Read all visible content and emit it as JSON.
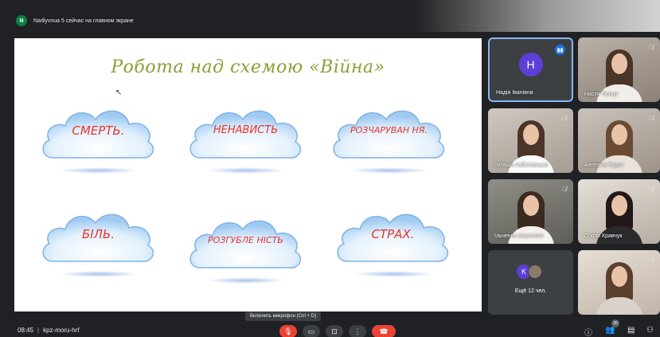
{
  "notification": {
    "avatar_letter": "N",
    "text": "Nadiyvnua 5 сейчас на главном экране"
  },
  "slide": {
    "title": "Робота над схемою «Війна»",
    "clouds": [
      "СМЕРТЬ.",
      "НЕНАВИСТЬ",
      "РОЗЧАРУВАН НЯ.",
      "БІЛЬ.",
      "РОЗГУБЛЕ НІСТЬ",
      "СТРАХ."
    ]
  },
  "participants": [
    {
      "name": "Надія Іванівна",
      "avatar_letter": "H",
      "speaking": true
    },
    {
      "name": "Настя Ткачук",
      "muted": true
    },
    {
      "name": "наташа лабачевська",
      "muted": true
    },
    {
      "name": "Ангеліна Рудич",
      "muted": true
    },
    {
      "name": "Ільченко Анастасія",
      "muted": true
    },
    {
      "name": "Софія Кравчук",
      "muted": true
    },
    {
      "name": "",
      "muted": true
    }
  ],
  "more_tile": {
    "avatar_letter": "K",
    "label": "Ещё 12 чел."
  },
  "tooltip": "Включить микрофон (Ctrl + D)",
  "meeting": {
    "time": "08:45",
    "code": "kpz-moru-hrf",
    "participants_count": "20"
  },
  "colors": {
    "accent": "#1a73e8",
    "end_call": "#ea4335",
    "slide_title": "#8aa035",
    "cloud_text": "#e8342c"
  },
  "icons": [
    "mic-off-icon",
    "camera-icon",
    "present-icon",
    "more-icon",
    "end-call-icon",
    "info-icon",
    "people-icon",
    "chat-icon",
    "activities-icon"
  ]
}
